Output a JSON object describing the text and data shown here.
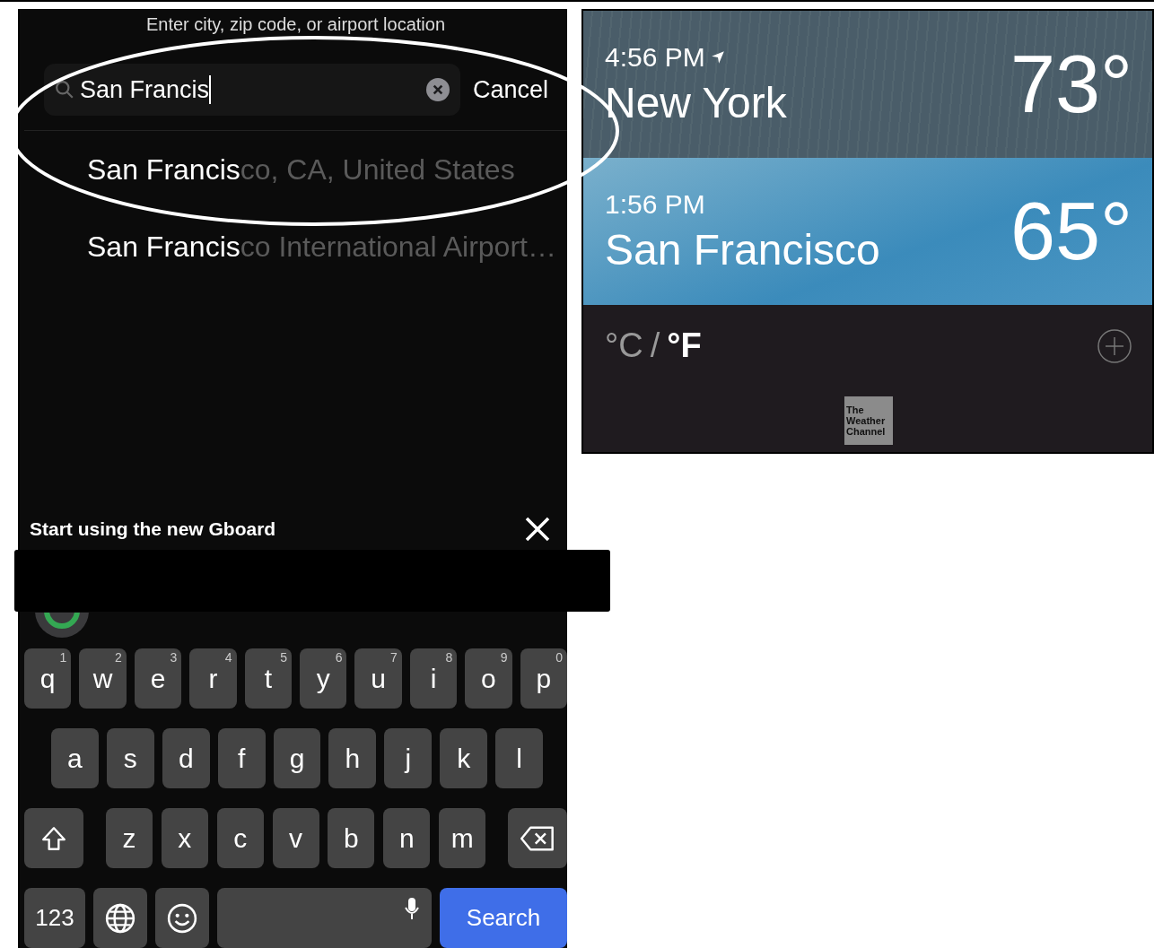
{
  "search_screen": {
    "prompt": "Enter city, zip code, or airport location",
    "search": {
      "value": "San Francis"
    },
    "cancel": "Cancel",
    "suggestions": [
      {
        "match": "San Francis",
        "rest": "co, CA, United States"
      },
      {
        "match": "San Francis",
        "rest": "co International Airport…"
      }
    ],
    "banner": {
      "title": "Start using the new Gboard"
    },
    "keyboard": {
      "rows": [
        {
          "keys": [
            {
              "kind": "letter",
              "label": "q",
              "hint": "1"
            },
            {
              "kind": "letter",
              "label": "w",
              "hint": "2"
            },
            {
              "kind": "letter",
              "label": "e",
              "hint": "3"
            },
            {
              "kind": "letter",
              "label": "r",
              "hint": "4"
            },
            {
              "kind": "letter",
              "label": "t",
              "hint": "5"
            },
            {
              "kind": "letter",
              "label": "y",
              "hint": "6"
            },
            {
              "kind": "letter",
              "label": "u",
              "hint": "7"
            },
            {
              "kind": "letter",
              "label": "i",
              "hint": "8"
            },
            {
              "kind": "letter",
              "label": "o",
              "hint": "9"
            },
            {
              "kind": "letter",
              "label": "p",
              "hint": "0"
            }
          ]
        },
        {
          "keys": [
            {
              "kind": "letter",
              "label": "a"
            },
            {
              "kind": "letter",
              "label": "s"
            },
            {
              "kind": "letter",
              "label": "d"
            },
            {
              "kind": "letter",
              "label": "f"
            },
            {
              "kind": "letter",
              "label": "g"
            },
            {
              "kind": "letter",
              "label": "h"
            },
            {
              "kind": "letter",
              "label": "j"
            },
            {
              "kind": "letter",
              "label": "k"
            },
            {
              "kind": "letter",
              "label": "l"
            }
          ]
        },
        {
          "keys": [
            {
              "kind": "shift"
            },
            {
              "kind": "letter",
              "label": "z"
            },
            {
              "kind": "letter",
              "label": "x"
            },
            {
              "kind": "letter",
              "label": "c"
            },
            {
              "kind": "letter",
              "label": "v"
            },
            {
              "kind": "letter",
              "label": "b"
            },
            {
              "kind": "letter",
              "label": "n"
            },
            {
              "kind": "letter",
              "label": "m"
            },
            {
              "kind": "backspace"
            }
          ]
        },
        {
          "keys": [
            {
              "kind": "numbers",
              "label": "123"
            },
            {
              "kind": "globe"
            },
            {
              "kind": "emoji"
            },
            {
              "kind": "space"
            },
            {
              "kind": "action",
              "label": "Search"
            }
          ]
        }
      ]
    }
  },
  "weather_screen": {
    "cities": [
      {
        "time": "4:56 PM",
        "current_location": true,
        "name": "New York",
        "temperature": "73°",
        "kind": "rain"
      },
      {
        "time": "1:56 PM",
        "current_location": false,
        "name": "San Francisco",
        "temperature": "65°",
        "kind": "clear"
      }
    ],
    "units": [
      {
        "label": "°C",
        "selected": false
      },
      {
        "label": "°F",
        "selected": true
      }
    ],
    "unit_separator": "/",
    "logo_lines": [
      "The",
      "Weather",
      "Channel"
    ]
  }
}
